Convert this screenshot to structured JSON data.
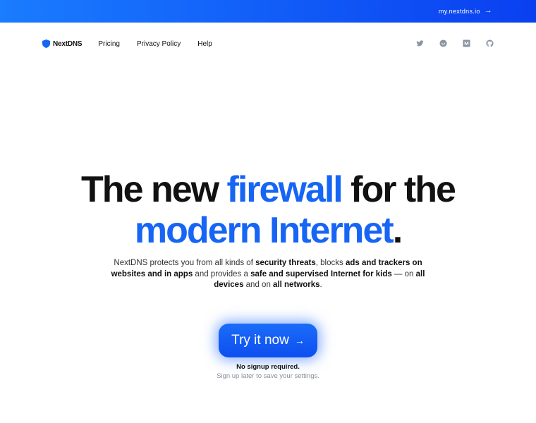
{
  "topbar": {
    "account_link": "my.nextdns.io",
    "arrow": "→"
  },
  "nav": {
    "logo_text": "NextDNS",
    "links": [
      "Pricing",
      "Privacy Policy",
      "Help"
    ]
  },
  "social_icons": [
    "twitter-icon",
    "reddit-icon",
    "medium-icon",
    "github-icon"
  ],
  "hero": {
    "line1_a": "The new ",
    "line1_accent": "firewall",
    "line1_b": " for the",
    "line2_accent": "modern Internet",
    "line2_dot": "."
  },
  "description": {
    "t1": "NextDNS protects you from all kinds of ",
    "b1": "security threats",
    "t2": ", blocks ",
    "b2": "ads and trackers on websites and in apps",
    "t3": " and provides a ",
    "b3": "safe and supervised Internet for kids",
    "t4": " — on ",
    "b4": "all devices",
    "t5": " and on ",
    "b5": "all networks",
    "t6": "."
  },
  "cta": {
    "label": "Try it now",
    "arrow": "→"
  },
  "signup": {
    "note": "No signup required.",
    "sub": "Sign up later to save your settings."
  },
  "colors": {
    "accent": "#1665f5",
    "topbar_start": "#1a7cff",
    "topbar_end": "#0a3ff0",
    "icon_gray": "#8a93a3"
  }
}
